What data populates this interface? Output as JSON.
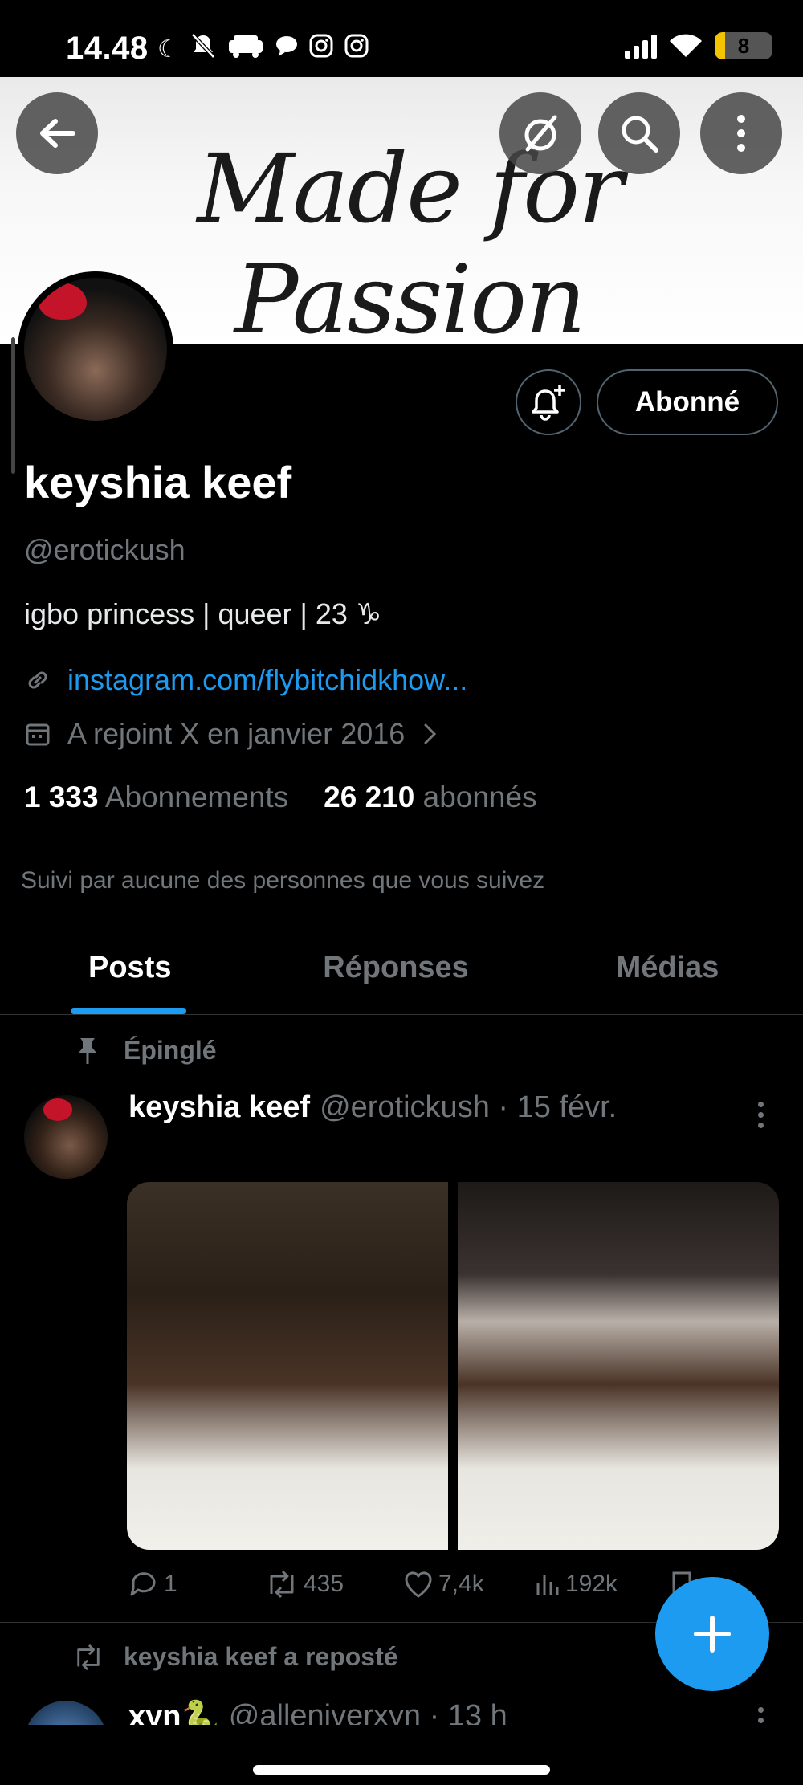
{
  "status_bar": {
    "time": "14.48",
    "battery": "8",
    "icons": [
      "moon-icon",
      "muted-bell-icon",
      "car-icon",
      "chat-icon",
      "instagram-icon",
      "instagram-icon",
      "signal-icon",
      "wifi-icon",
      "battery-icon"
    ]
  },
  "banner": {
    "text": "Made for Passion"
  },
  "profile": {
    "follow_button": "Abonné",
    "name": "keyshia keef",
    "handle": "@erotickush",
    "bio": "igbo princess | queer | 23 ♑",
    "link": "instagram.com/flybitchidkhow...",
    "joined": "A rejoint X en janvier 2016",
    "following_count": "1 333",
    "following_label": "Abonnements",
    "followers_count": "26 210",
    "followers_label": "abonnés",
    "followed_by": "Suivi par aucune des personnes que vous suivez"
  },
  "tabs": [
    {
      "label": "Posts",
      "active": true
    },
    {
      "label": "Réponses",
      "active": false
    },
    {
      "label": "Médias",
      "active": false
    }
  ],
  "pinned_post": {
    "pinned_label": "Épinglé",
    "author": "keyshia keef",
    "handle_date": "@erotickush · 15 févr.",
    "replies": "1",
    "reposts": "435",
    "likes": "7,4k",
    "views": "192k"
  },
  "next_post": {
    "repost_label": "keyshia keef a reposté",
    "author": "xyn🐍",
    "handle_date": "@alleniverxyn · 13 h"
  },
  "colors": {
    "accent": "#1d9bf0",
    "background": "#000000",
    "muted_text": "#71767b"
  }
}
